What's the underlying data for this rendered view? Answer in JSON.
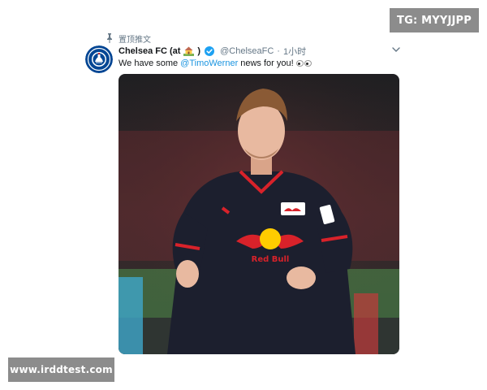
{
  "tweet": {
    "pinned_label": "置顶推文",
    "display_name": "Chelsea FC (at",
    "display_name_suffix": ")",
    "handle": "@ChelseaFC",
    "separator": "·",
    "timestamp": "1小时",
    "text_before": "We have some",
    "mention": "@TimoWerner",
    "text_after": "news for you!",
    "icons": [
      "pin-icon",
      "house-emoji-icon",
      "verified-icon",
      "chevron-down-icon",
      "eyes-emoji-icon"
    ]
  },
  "avatar_badge": {
    "text": "CHELSEA FOOTBALL CLUB"
  },
  "media": {
    "sponsor_text": "Red Bull"
  },
  "watermarks": {
    "top": "TG: MYYJJPP",
    "bottom": "www.irddtest.com"
  },
  "colors": {
    "link": "#1b95e0",
    "secondary_text": "#657786",
    "verified": "#1da1f2",
    "chelsea_blue": "#034694"
  }
}
